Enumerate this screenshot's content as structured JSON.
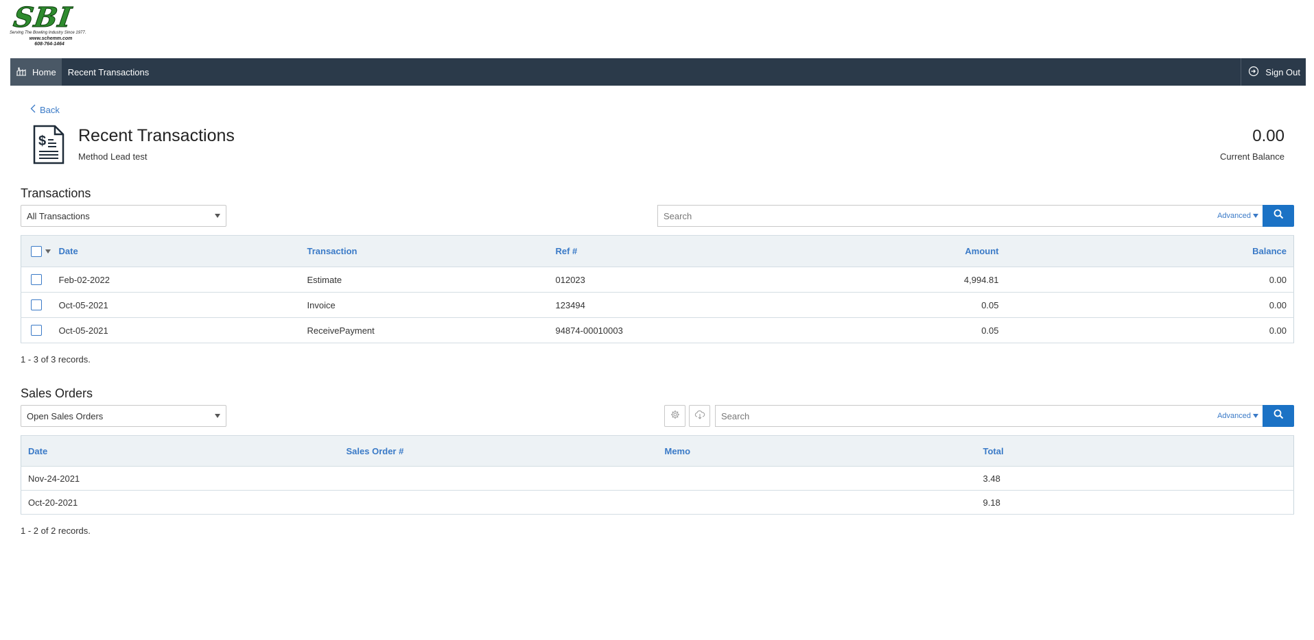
{
  "logo": {
    "main": "SBI",
    "tagline": "Serving The Bowling Industry Since 1977.",
    "url": "www.schemm.com",
    "phone": "608-764-1464"
  },
  "nav": {
    "home_label": "Home",
    "breadcrumb": "Recent Transactions",
    "signout_label": "Sign Out"
  },
  "header": {
    "back_label": "Back",
    "title": "Recent Transactions",
    "subtitle": "Method Lead test",
    "balance_value": "0.00",
    "balance_label": "Current Balance"
  },
  "transactions": {
    "section_title": "Transactions",
    "filter_selected": "All Transactions",
    "search_placeholder": "Search",
    "advanced_label": "Advanced",
    "columns": [
      "Date",
      "Transaction",
      "Ref #",
      "Amount",
      "Balance"
    ],
    "rows": [
      {
        "date": "Feb-02-2022",
        "transaction": "Estimate",
        "ref": "012023",
        "amount": "4,994.81",
        "balance": "0.00"
      },
      {
        "date": "Oct-05-2021",
        "transaction": "Invoice",
        "ref": "123494",
        "amount": "0.05",
        "balance": "0.00"
      },
      {
        "date": "Oct-05-2021",
        "transaction": "ReceivePayment",
        "ref": "94874-00010003",
        "amount": "0.05",
        "balance": "0.00"
      }
    ],
    "records_text": "1 - 3 of 3 records."
  },
  "sales_orders": {
    "section_title": "Sales Orders",
    "filter_selected": "Open Sales Orders",
    "search_placeholder": "Search",
    "advanced_label": "Advanced",
    "columns": [
      "Date",
      "Sales Order #",
      "Memo",
      "Total"
    ],
    "rows": [
      {
        "date": "Nov-24-2021",
        "order": "",
        "memo": "",
        "total": "3.48"
      },
      {
        "date": "Oct-20-2021",
        "order": "",
        "memo": "",
        "total": "9.18"
      }
    ],
    "records_text": "1 - 2 of 2 records."
  },
  "colors": {
    "navbar": "#2b3a4a",
    "accent": "#1b72c5",
    "link": "#3a7ac7",
    "logo_green": "#2e8b2e"
  }
}
